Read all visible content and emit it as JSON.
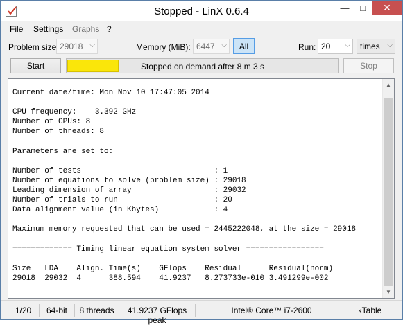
{
  "window": {
    "title": "Stopped - LinX 0.6.4"
  },
  "menu": {
    "file": "File",
    "settings": "Settings",
    "graphs": "Graphs",
    "help": "?"
  },
  "toolbar": {
    "problem_size_label": "Problem size:",
    "problem_size_value": "29018",
    "memory_label": "Memory (MiB):",
    "memory_value": "6447",
    "all_button": "All",
    "run_label": "Run:",
    "run_value": "20",
    "run_unit": "times"
  },
  "controls": {
    "start": "Start",
    "stop": "Stop",
    "status_text": "Stopped on demand after 8 m 3 s",
    "progress_fraction": 0.19,
    "progress_color": "#fae60a"
  },
  "console": {
    "lines": [
      "Current date/time: Mon Nov 10 17:47:05 2014",
      "",
      "CPU frequency:    3.392 GHz",
      "Number of CPUs: 8",
      "Number of threads: 8",
      "",
      "Parameters are set to:",
      "",
      "Number of tests                             : 1",
      "Number of equations to solve (problem size) : 29018",
      "Leading dimension of array                  : 29032",
      "Number of trials to run                     : 20",
      "Data alignment value (in Kbytes)            : 4",
      "",
      "Maximum memory requested that can be used = 2445222048, at the size = 29018",
      "",
      "============= Timing linear equation system solver =================",
      "",
      "Size   LDA    Align. Time(s)    GFlops    Residual      Residual(norm)",
      "29018  29032  4      388.594    41.9237   8.273733e-010 3.491299e-002"
    ]
  },
  "status": {
    "trial": "1/20",
    "bits": "64-bit",
    "threads": "8 threads",
    "peak": "41.9237 GFlops peak",
    "cpu": "Intel® Core™ i7-2600",
    "table": "‹Table"
  }
}
